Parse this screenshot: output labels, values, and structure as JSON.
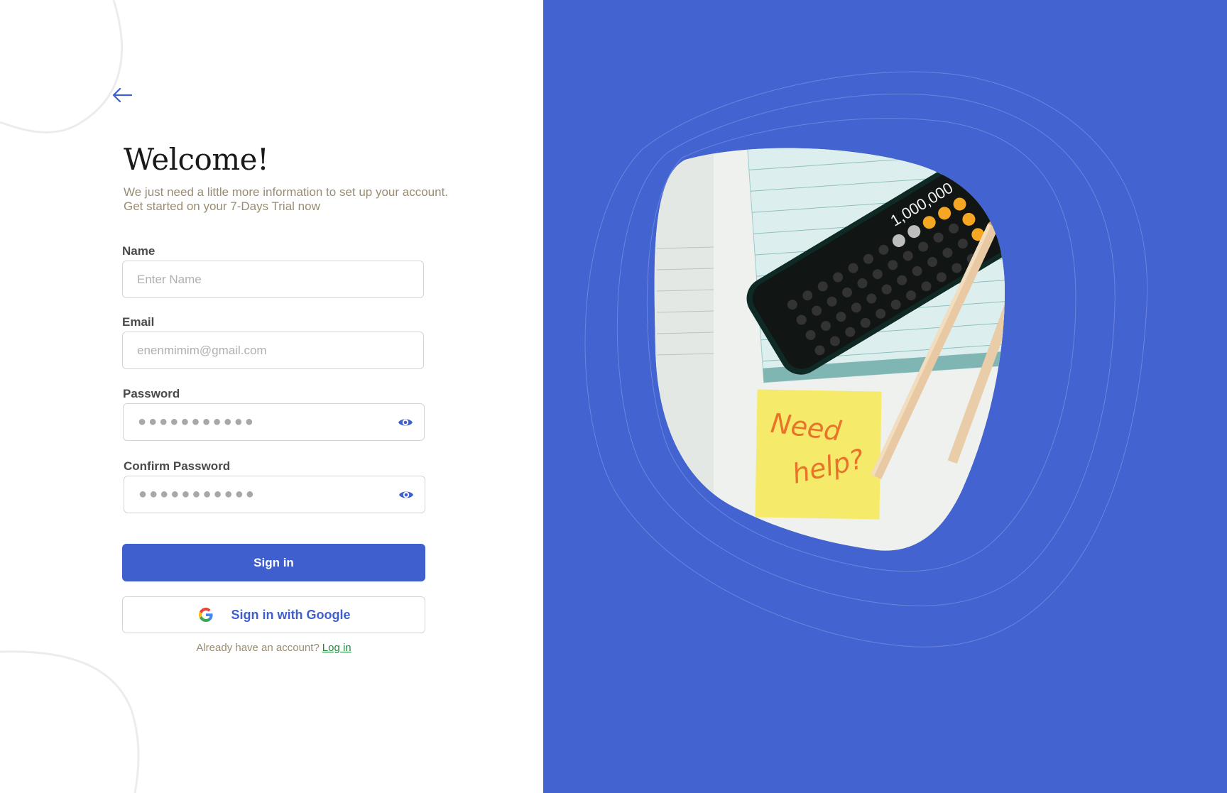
{
  "form": {
    "title": "Welcome!",
    "subtitle_line1": "We just need a little more information to set up your account.",
    "subtitle_line2": "Get started on your 7-Days Trial now",
    "name_label": "Name",
    "name_placeholder": "Enter Name",
    "email_label": "Email",
    "email_placeholder": "enenmimim@gmail.com",
    "password_label": "Password",
    "password_placeholder": "●●●●●●●●●●●",
    "confirm_label": "Confirm Password",
    "confirm_placeholder": "●●●●●●●●●●●",
    "signin_label": "Sign in",
    "google_label": "Sign in with Google",
    "footer_text": "Already have an account?",
    "login_link": "Log in"
  },
  "illustration": {
    "calculator_display": "1,000,000",
    "sticky_note_line1": "Need",
    "sticky_note_line2": "help?"
  },
  "colors": {
    "brand_blue": "#3f5fcf",
    "panel_blue": "#4263d0",
    "link_green": "#1f8a3a",
    "subtitle_tan": "#9a8c70"
  },
  "icons": {
    "back": "arrow-left-icon",
    "password_toggle": "eye-icon",
    "google": "google-logo-icon"
  }
}
